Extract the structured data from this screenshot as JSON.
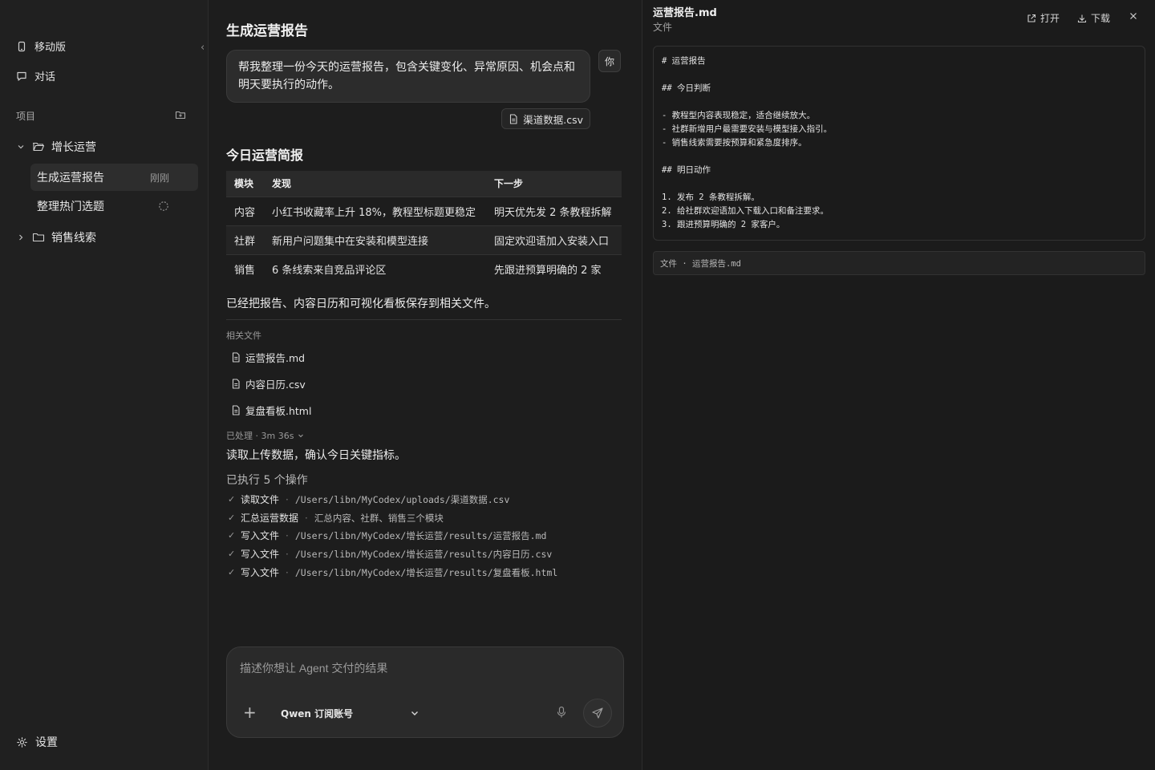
{
  "sidebar": {
    "mobile_label": "移动版",
    "chat_label": "对话",
    "projects_label": "项目",
    "projects": [
      {
        "name": "增长运营",
        "expanded": true,
        "tasks": [
          {
            "label": "生成运营报告",
            "meta": "刚刚",
            "active": true
          },
          {
            "label": "整理热门选题",
            "status": "loading"
          }
        ]
      },
      {
        "name": "销售线索",
        "expanded": false
      }
    ],
    "settings_label": "设置"
  },
  "main": {
    "title": "生成运营报告",
    "user_message": "帮我整理一份今天的运营报告，包含关键变化、异常原因、机会点和明天要执行的动作。",
    "user_avatar": "你",
    "attachment": "渠道数据.csv",
    "section_title": "今日运营简报",
    "table": {
      "headers": [
        "模块",
        "发现",
        "下一步"
      ],
      "rows": [
        [
          "内容",
          "小红书收藏率上升 18%，教程型标题更稳定",
          "明天优先发 2 条教程拆解"
        ],
        [
          "社群",
          "新用户问题集中在安装和模型连接",
          "固定欢迎语加入安装入口"
        ],
        [
          "销售",
          "6 条线索来自竞品评论区",
          "先跟进预算明确的 2 家"
        ]
      ]
    },
    "saved_note": "已经把报告、内容日历和可视化看板保存到相关文件。",
    "related_label": "相关文件",
    "related_files": [
      "运营报告.md",
      "内容日历.csv",
      "复盘看板.html"
    ],
    "processed_label": "已处理 · 3m 36s",
    "read_note": "读取上传数据，确认今日关键指标。",
    "ops_title": "已执行 5 个操作",
    "operations": [
      {
        "action": "读取文件",
        "detail": "/Users/libn/MyCodex/uploads/渠道数据.csv",
        "mono": true
      },
      {
        "action": "汇总运营数据",
        "detail": "汇总内容、社群、销售三个模块",
        "mono": false
      },
      {
        "action": "写入文件",
        "detail": "/Users/libn/MyCodex/增长运营/results/运营报告.md",
        "mono": true
      },
      {
        "action": "写入文件",
        "detail": "/Users/libn/MyCodex/增长运营/results/内容日历.csv",
        "mono": true
      },
      {
        "action": "写入文件",
        "detail": "/Users/libn/MyCodex/增长运营/results/复盘看板.html",
        "mono": true
      }
    ],
    "composer": {
      "placeholder": "描述你想让 Agent 交付的结果",
      "model": "Qwen 订阅账号"
    }
  },
  "panel": {
    "title": "运营报告.md",
    "subtitle": "文件",
    "open_label": "打开",
    "download_label": "下载",
    "doc_lines": [
      "# 运营报告",
      "",
      "## 今日判断",
      "",
      "- 教程型内容表现稳定，适合继续放大。",
      "- 社群新增用户最需要安装与模型接入指引。",
      "- 销售线索需要按预算和紧急度排序。",
      "",
      "## 明日动作",
      "",
      "1. 发布 2 条教程拆解。",
      "2. 给社群欢迎语加入下载入口和备注要求。",
      "3. 跟进预算明确的 2 家客户。"
    ],
    "footer": "文件 · 运营报告.md"
  }
}
